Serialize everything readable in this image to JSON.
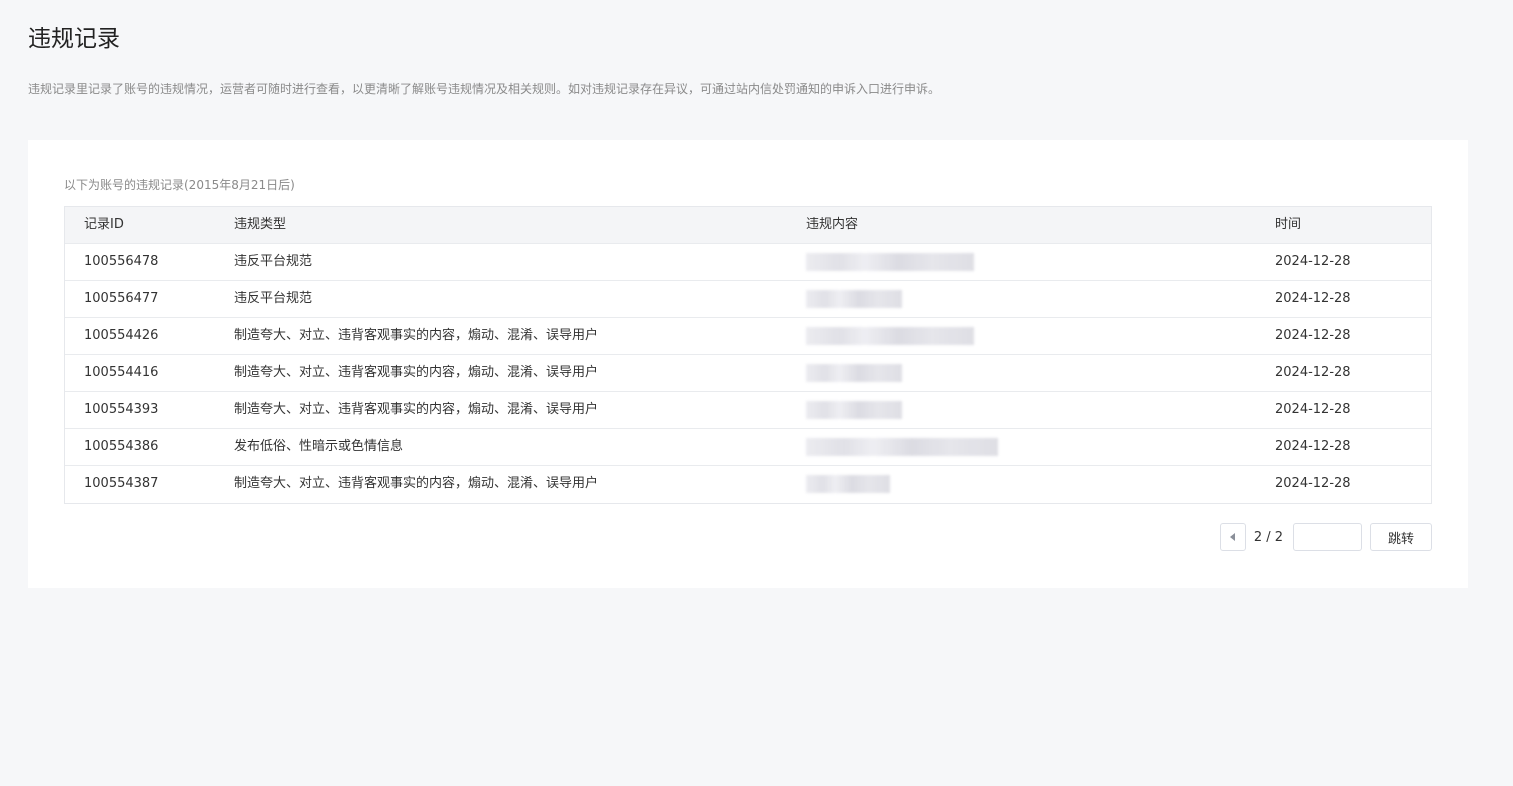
{
  "page": {
    "title": "违规记录",
    "description": "违规记录里记录了账号的违规情况，运营者可随时进行查看，以更清晰了解账号违规情况及相关规则。如对违规记录存在异议，可通过站内信处罚通知的申诉入口进行申诉。"
  },
  "table": {
    "caption": "以下为账号的违规记录(2015年8月21日后)",
    "headers": {
      "id": "记录ID",
      "type": "违规类型",
      "content": "违规内容",
      "time": "时间"
    },
    "rows": [
      {
        "id": "100556478",
        "type": "违反平台规范",
        "time": "2024-12-28"
      },
      {
        "id": "100556477",
        "type": "违反平台规范",
        "time": "2024-12-28"
      },
      {
        "id": "100554426",
        "type": "制造夸大、对立、违背客观事实的内容，煽动、混淆、误导用户",
        "time": "2024-12-28"
      },
      {
        "id": "100554416",
        "type": "制造夸大、对立、违背客观事实的内容，煽动、混淆、误导用户",
        "time": "2024-12-28"
      },
      {
        "id": "100554393",
        "type": "制造夸大、对立、违背客观事实的内容，煽动、混淆、误导用户",
        "time": "2024-12-28"
      },
      {
        "id": "100554386",
        "type": "发布低俗、性暗示或色情信息",
        "time": "2024-12-28"
      },
      {
        "id": "100554387",
        "type": "制造夸大、对立、违背客观事实的内容，煽动、混淆、误导用户",
        "time": "2024-12-28"
      }
    ]
  },
  "pager": {
    "page_text": "2 / 2",
    "input_value": "",
    "go_label": "跳转"
  }
}
